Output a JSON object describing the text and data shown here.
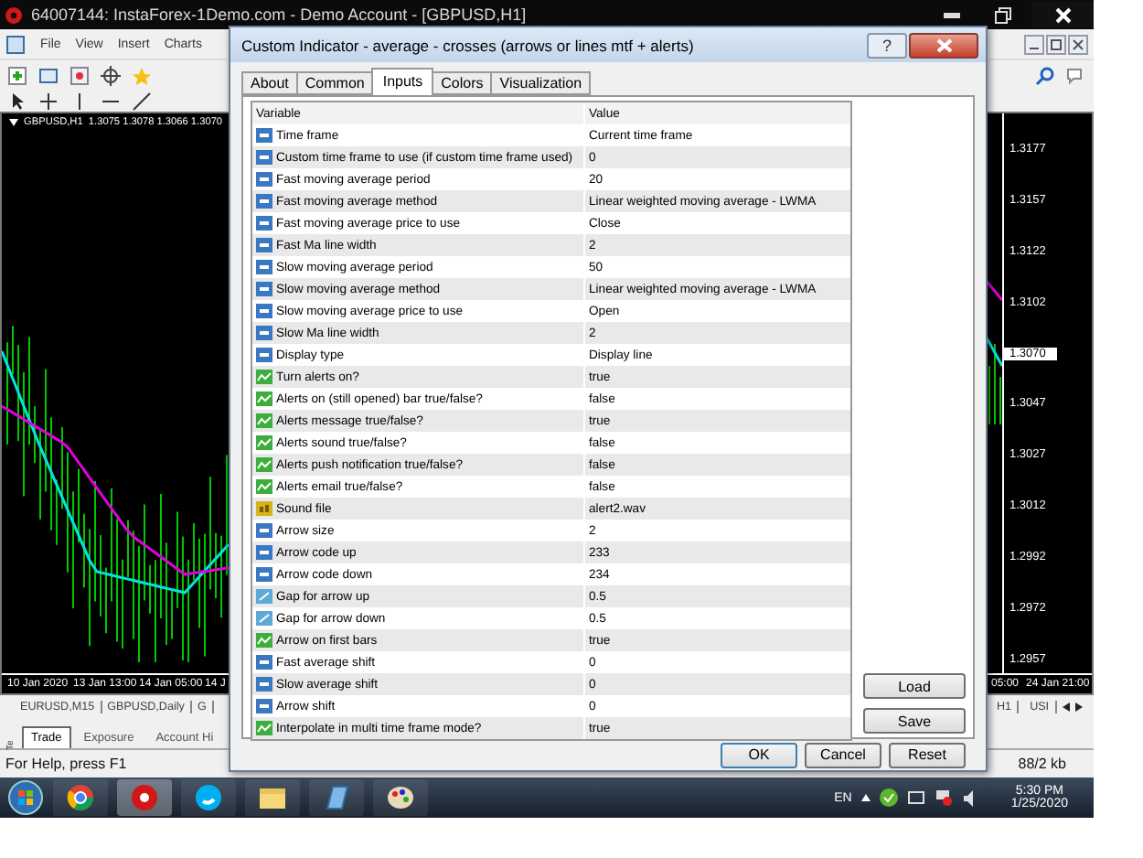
{
  "main_window": {
    "title": "64007144: InstaForex-1Demo.com - Demo Account - [GBPUSD,H1]",
    "menu": [
      "File",
      "View",
      "Insert",
      "Charts"
    ]
  },
  "chart": {
    "header": "GBPUSD,H1  1.3075 1.3078 1.3066 1.3070",
    "price_labels": [
      {
        "text": "1.3177",
        "kind": "tick"
      },
      {
        "text": "1.3157",
        "kind": "tick"
      },
      {
        "text": "1.3122",
        "kind": "tick"
      },
      {
        "text": "1.3102",
        "kind": "tick"
      },
      {
        "text": "1.3070",
        "kind": "current"
      },
      {
        "text": "1.3047",
        "kind": "tick"
      },
      {
        "text": "1.3027",
        "kind": "tick"
      },
      {
        "text": "1.3012",
        "kind": "tick"
      },
      {
        "text": "1.2992",
        "kind": "tick"
      },
      {
        "text": "1.2972",
        "kind": "tick"
      },
      {
        "text": "1.2957",
        "kind": "tick"
      }
    ],
    "time_labels_left": [
      "10 Jan 2020",
      "13 Jan 13:00",
      "14 Jan 05:00",
      "14 J"
    ],
    "time_labels_right": [
      "05:00",
      "24 Jan 21:00"
    ]
  },
  "chart_tabs_left": [
    "EURUSD,M15",
    "GBPUSD,Daily",
    "G"
  ],
  "chart_tabs_right": [
    "H1",
    "USI"
  ],
  "terminal": {
    "side_label": "Te",
    "tabs": [
      {
        "label": "Trade",
        "selected": true
      },
      {
        "label": "Exposure",
        "selected": false
      },
      {
        "label": "Account Hi",
        "selected": false
      }
    ]
  },
  "status": {
    "left": "For Help, press F1",
    "right": "88/2 kb"
  },
  "dialog": {
    "title": "Custom Indicator - average - crosses (arrows or lines mtf + alerts)",
    "help": "?",
    "tabs": [
      {
        "label": "About",
        "selected": false
      },
      {
        "label": "Common",
        "selected": false
      },
      {
        "label": "Inputs",
        "selected": true
      },
      {
        "label": "Colors",
        "selected": false
      },
      {
        "label": "Visualization",
        "selected": false
      }
    ],
    "columns": [
      "Variable",
      "Value"
    ],
    "rows": [
      {
        "kind": "int",
        "variable": "Time frame",
        "value": "Current time frame"
      },
      {
        "kind": "int",
        "variable": "Custom time frame to use (if custom time frame used)",
        "value": "0"
      },
      {
        "kind": "int",
        "variable": "Fast moving average period",
        "value": "20"
      },
      {
        "kind": "int",
        "variable": "Fast moving average method",
        "value": "Linear weighted moving average - LWMA"
      },
      {
        "kind": "int",
        "variable": "Fast moving average price to use",
        "value": "Close"
      },
      {
        "kind": "int",
        "variable": "Fast Ma line width",
        "value": "2"
      },
      {
        "kind": "int",
        "variable": "Slow moving average period",
        "value": "50"
      },
      {
        "kind": "int",
        "variable": "Slow moving average method",
        "value": "Linear weighted moving average - LWMA"
      },
      {
        "kind": "int",
        "variable": "Slow moving average price to use",
        "value": "Open"
      },
      {
        "kind": "int",
        "variable": "Slow Ma line width",
        "value": "2"
      },
      {
        "kind": "int",
        "variable": "Display type",
        "value": "Display line"
      },
      {
        "kind": "bool",
        "variable": "Turn alerts on?",
        "value": "true"
      },
      {
        "kind": "bool",
        "variable": "Alerts on (still opened) bar true/false?",
        "value": "false"
      },
      {
        "kind": "bool",
        "variable": "Alerts message true/false?",
        "value": "true"
      },
      {
        "kind": "bool",
        "variable": "Alerts sound true/false?",
        "value": "false"
      },
      {
        "kind": "bool",
        "variable": "Alerts push notification true/false?",
        "value": "false"
      },
      {
        "kind": "bool",
        "variable": "Alerts email true/false?",
        "value": "false"
      },
      {
        "kind": "str",
        "variable": "Sound file",
        "value": "alert2.wav"
      },
      {
        "kind": "int",
        "variable": "Arrow size",
        "value": "2"
      },
      {
        "kind": "int",
        "variable": "Arrow code up",
        "value": "233"
      },
      {
        "kind": "int",
        "variable": "Arrow code down",
        "value": "234"
      },
      {
        "kind": "dbl",
        "variable": "Gap for arrow up",
        "value": "0.5"
      },
      {
        "kind": "dbl",
        "variable": "Gap for arrow down",
        "value": "0.5"
      },
      {
        "kind": "bool",
        "variable": "Arrow on first bars",
        "value": "true"
      },
      {
        "kind": "int",
        "variable": "Fast average shift",
        "value": "0"
      },
      {
        "kind": "int",
        "variable": "Slow average shift",
        "value": "0"
      },
      {
        "kind": "int",
        "variable": "Arrow shift",
        "value": "0"
      },
      {
        "kind": "bool",
        "variable": "Interpolate in multi time frame mode?",
        "value": "true"
      }
    ],
    "side_buttons": [
      "Load",
      "Save"
    ],
    "buttons": [
      "OK",
      "Cancel",
      "Reset"
    ]
  },
  "taskbar": {
    "language": "EN",
    "time": "5:30 PM",
    "date": "1/25/2020"
  }
}
